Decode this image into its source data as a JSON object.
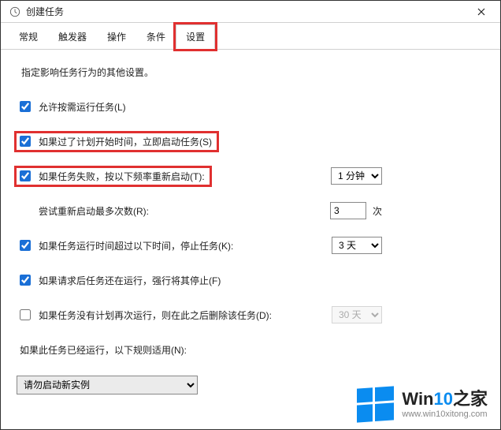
{
  "window": {
    "title": "创建任务"
  },
  "tabs": [
    {
      "label": "常规"
    },
    {
      "label": "触发器"
    },
    {
      "label": "操作"
    },
    {
      "label": "条件"
    },
    {
      "label": "设置",
      "active": true
    }
  ],
  "description": "指定影响任务行为的其他设置。",
  "settings": {
    "allow_on_demand": {
      "label": "允许按需运行任务(L)",
      "checked": true
    },
    "run_asap": {
      "label": "如果过了计划开始时间，立即启动任务(S)",
      "checked": true
    },
    "restart_on_fail": {
      "label": "如果任务失败，按以下频率重新启动(T):",
      "checked": true,
      "interval": "1 分钟"
    },
    "restart_max": {
      "label": "尝试重新启动最多次数(R):",
      "value": "3",
      "suffix": "次"
    },
    "stop_if_longer": {
      "label": "如果任务运行时间超过以下时间，停止任务(K):",
      "checked": true,
      "value": "3 天"
    },
    "force_stop": {
      "label": "如果请求后任务还在运行，强行将其停止(F)",
      "checked": true
    },
    "delete_after": {
      "label": "如果任务没有计划再次运行，则在此之后删除该任务(D):",
      "checked": false,
      "value": "30 天"
    },
    "already_running": {
      "label": "如果此任务已经运行，以下规则适用(N):"
    },
    "rule": {
      "value": "请勿启动新实例"
    }
  },
  "watermark": {
    "brand_a": "Win",
    "brand_b": "10",
    "brand_c": "之家",
    "url": "www.win10xitong.com"
  }
}
